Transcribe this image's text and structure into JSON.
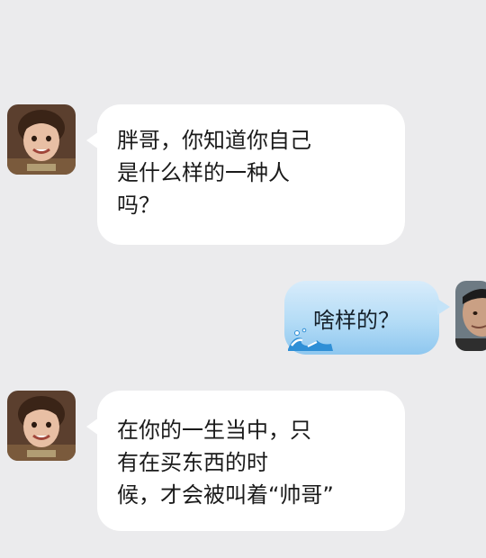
{
  "messages": [
    {
      "sender": "left",
      "lines": [
        "胖哥，你知道你自己",
        "是什么样的一种人",
        "吗？"
      ]
    },
    {
      "sender": "right",
      "lines": [
        "啥样的？"
      ]
    },
    {
      "sender": "left",
      "lines": [
        "在你的一生当中，只",
        "有在买东西的时",
        "候，才会被叫着“帅哥”"
      ]
    }
  ],
  "colors": {
    "background": "#ebebed",
    "incoming_bubble": "#ffffff",
    "outgoing_bubble": "#b4dcf6"
  },
  "icons": {
    "avatar_left": "child-avatar",
    "avatar_right": "man-avatar",
    "bubble_decoration": "wave-icon"
  }
}
